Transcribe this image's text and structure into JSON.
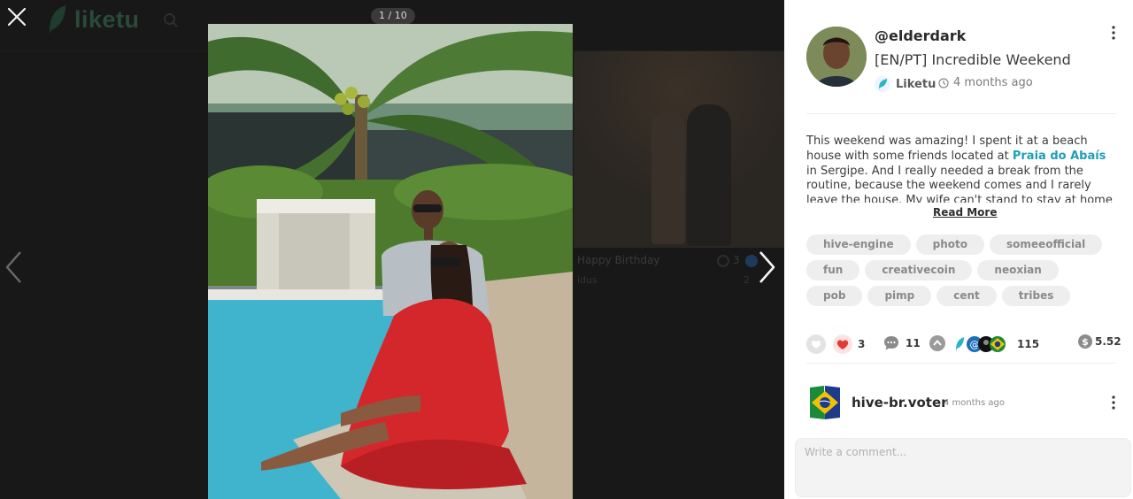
{
  "background": {
    "logo_text": "liketu",
    "card": {
      "title": "Happy Birthday",
      "author": "idus",
      "count": "3",
      "small": "2"
    }
  },
  "viewer": {
    "counter": "1 / 10",
    "close_icon": "close-icon",
    "prev_icon": "chevron-left-icon",
    "next_icon": "chevron-right-icon"
  },
  "post": {
    "username": "@elderdark",
    "title": "[EN/PT] Incredible Weekend",
    "community": "Liketu",
    "time": "4 months ago",
    "body_before": "This weekend was amazing! I spent it at a beach house with some friends located at ",
    "body_highlight": "Praia do Abaís",
    "body_after": " in Sergipe. And I really needed a break from the routine, because the weekend comes and I rarely leave the house. My wife can't stand to stay at home anymore. 😅",
    "read_more": "Read More",
    "tags": [
      "hive-engine",
      "photo",
      "someeofficial",
      "fun",
      "creativecoin",
      "neoxian",
      "pob",
      "pimp",
      "cent",
      "tribes"
    ],
    "stats": {
      "likes": "3",
      "comments": "11",
      "voters": "115",
      "payout": "5.52"
    }
  },
  "comment": {
    "user": "hive-br.voter",
    "time": "4 months ago",
    "placeholder": "Write a comment..."
  },
  "colors": {
    "accent": "#1f9fb6",
    "heart": "#e53935",
    "panel_bg": "#ffffff",
    "overlay_bg": "#131313"
  }
}
